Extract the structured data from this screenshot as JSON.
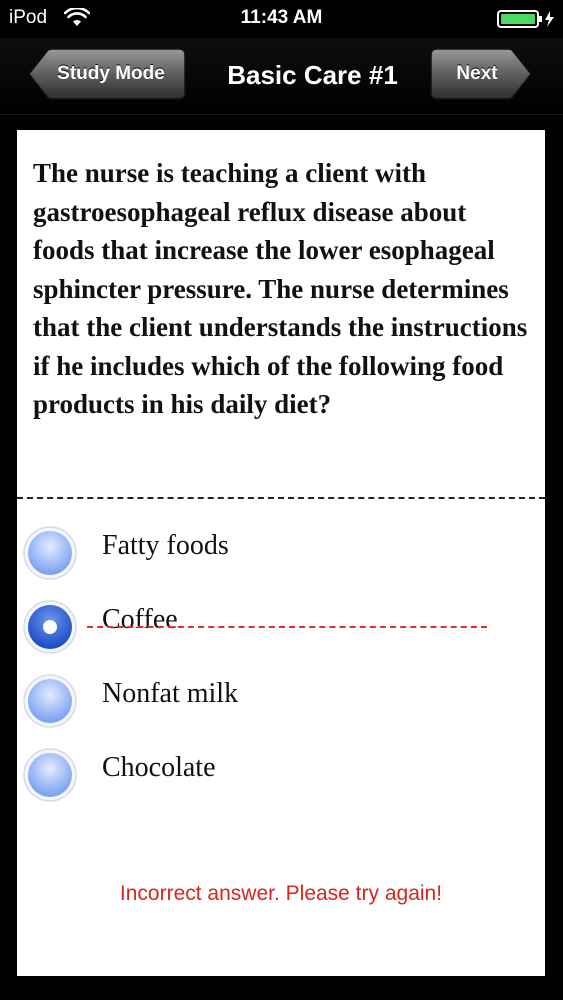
{
  "status_bar": {
    "carrier": "iPod",
    "time": "11:43 AM"
  },
  "nav": {
    "back_label": "Study Mode",
    "title": "Basic Care #1",
    "next_label": "Next"
  },
  "question": {
    "text": "The nurse is teaching a client with gastroesophageal reflux disease about foods that increase the lower esophageal sphincter pressure. The nurse determines that the client understands the instructions if he includes which of the following food products in his daily diet?"
  },
  "answers": [
    {
      "label": "Fatty foods",
      "selected": false,
      "struck": false
    },
    {
      "label": "Coffee",
      "selected": true,
      "struck": true
    },
    {
      "label": "Nonfat milk",
      "selected": false,
      "struck": false
    },
    {
      "label": "Chocolate",
      "selected": false,
      "struck": false
    }
  ],
  "feedback": "Incorrect answer. Please try again!",
  "colors": {
    "feedback": "#d9251c",
    "radio": "#8aaef5",
    "radio_selected": "#2f5fd6",
    "strike": "#e03030"
  },
  "icons": {
    "wifi": "wifi-icon",
    "battery": "battery-icon",
    "radio": "radio-icon"
  }
}
